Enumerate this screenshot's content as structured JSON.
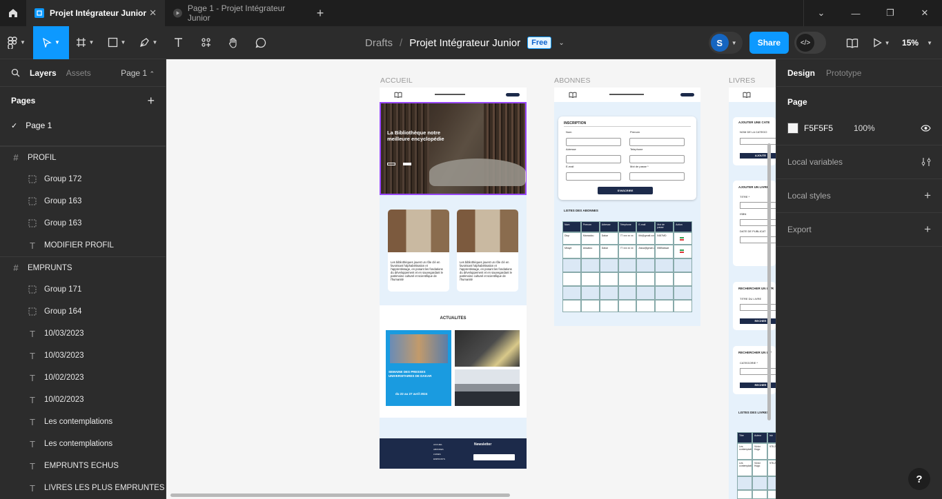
{
  "tabs": [
    {
      "label": "Projet Intégrateur Junior",
      "active": true
    },
    {
      "label": "Page 1 - Projet Intégrateur Junior",
      "active": false
    }
  ],
  "toolbar": {
    "breadcrumb_root": "Drafts",
    "breadcrumb_sep": "/",
    "project_name": "Projet Intégrateur Junior",
    "plan_badge": "Free",
    "avatar_initial": "S",
    "share_label": "Share",
    "zoom": "15%"
  },
  "left_panel": {
    "tab_layers": "Layers",
    "tab_assets": "Assets",
    "page_selector": "Page 1",
    "pages_heading": "Pages",
    "pages": [
      {
        "label": "Page 1",
        "current": true
      }
    ],
    "layers": [
      {
        "label": "PROFIL",
        "type": "frame"
      },
      {
        "label": "Group 172",
        "type": "group"
      },
      {
        "label": "Group 163",
        "type": "group"
      },
      {
        "label": "Group 163",
        "type": "group"
      },
      {
        "label": "MODIFIER PROFIL",
        "type": "text"
      },
      {
        "label": "EMPRUNTS",
        "type": "frame"
      },
      {
        "label": "Group 171",
        "type": "group"
      },
      {
        "label": "Group 164",
        "type": "group"
      },
      {
        "label": "10/03/2023",
        "type": "text"
      },
      {
        "label": "10/03/2023",
        "type": "text"
      },
      {
        "label": "10/02/2023",
        "type": "text"
      },
      {
        "label": "10/02/2023",
        "type": "text"
      },
      {
        "label": "Les contemplations",
        "type": "text"
      },
      {
        "label": "Les contemplations",
        "type": "text"
      },
      {
        "label": "EMPRUNTS ECHUS",
        "type": "text"
      },
      {
        "label": "LIVRES LES PLUS EMPRUNTES",
        "type": "text"
      }
    ]
  },
  "canvas": {
    "background": "#F5F5F5",
    "frames": [
      {
        "label": "ACCUEIL"
      },
      {
        "label": "ABONNES"
      },
      {
        "label": "LIVRES"
      }
    ],
    "accueil": {
      "hero_title": "La Bibliothèque notre meilleure encyclopédie",
      "card_text": "Les bibliothèques jouent un rôle clé en favorisant l'alphabétisation et l'apprentissage, en posant les fondations du développement et en sauvegardant le patrimoine culturel et scientifique de l'humanité",
      "news_heading": "ACTUALITES",
      "poster_lines": [
        "SEMAINE DES PRESSES",
        "UNIVERSITAIRES DE DAKAR",
        "du 22 au 27 avril 2024"
      ],
      "footer_title": "Newsletter",
      "footer_links": [
        "ACCUEIL",
        "ABONNES",
        "LIVRES",
        "EMPRUNTS"
      ]
    },
    "abonnes": {
      "form_title": "INSCRIPTION",
      "fields": [
        "Nom",
        "Prenom",
        "Adresse",
        "Telephone",
        "E-mail",
        "Mot de passe *"
      ],
      "submit": "S'INSCRIRE",
      "list_title": "LISTES DES ABONNES",
      "columns": [
        "Nom",
        "Prenom",
        "Adresse",
        "Telephone",
        "E-mail",
        "Mot de passe",
        "Action"
      ],
      "rows": [
        [
          "Diop",
          "Mamadou",
          "Dakar",
          "77 xxx xx xx",
          "Md@gmail.com",
          "5487MD",
          ""
        ],
        [
          "Mbaye",
          "Aissatou",
          "Dakar",
          "77 xxx xx xx",
          "Aissa@gmail.com",
          "5585aissat",
          ""
        ]
      ]
    },
    "livres": {
      "sections": [
        "AJOUTER UNE CATE",
        "AJOUTER UN LIVRE",
        "RECHERCHER UN LIVR",
        "RECHERCHER UN LIV",
        "LISTES DES LIVRES"
      ],
      "labels": [
        "NOM DE LA CATEGO",
        "TITRE *",
        "ISBN",
        "DATE DE PUBLICAT",
        "TITRE DU LIVRE",
        "CATEGORIE *"
      ],
      "buttons": [
        "AJOUTE",
        "RECHER",
        "RECHER"
      ],
      "table_cols": [
        "Titre",
        "Auteur",
        "Isb"
      ],
      "table_rows": [
        [
          "Les contemplations",
          "Victor Hugo",
          "978-2-"
        ],
        [
          "Les contemplations",
          "Victor Hugo",
          "978-2-"
        ]
      ]
    }
  },
  "right_panel": {
    "tab_design": "Design",
    "tab_prototype": "Prototype",
    "page_heading": "Page",
    "page_color": "F5F5F5",
    "page_opacity": "100%",
    "local_variables": "Local variables",
    "local_styles": "Local styles",
    "export": "Export"
  },
  "help": "?"
}
